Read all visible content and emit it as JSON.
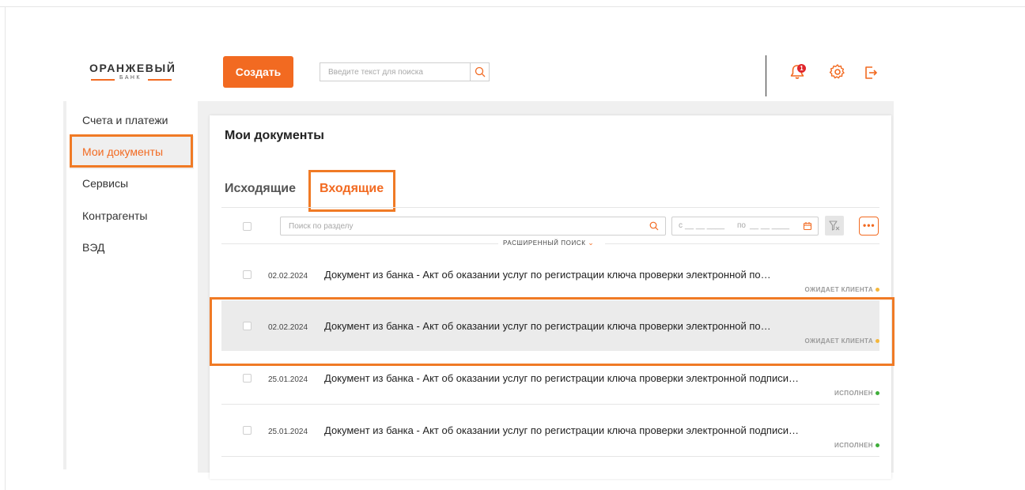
{
  "logo": {
    "name": "ОРАНЖЕВЫЙ",
    "subtitle": "БАНК"
  },
  "header": {
    "create_label": "Создать",
    "search_placeholder": "Введите текст для поиска",
    "notification_count": "1"
  },
  "sidebar": {
    "items": [
      {
        "label": "Счета и платежи",
        "active": false
      },
      {
        "label": "Мои документы",
        "active": true
      },
      {
        "label": "Сервисы",
        "active": false
      },
      {
        "label": "Контрагенты",
        "active": false
      },
      {
        "label": "ВЭД",
        "active": false
      }
    ]
  },
  "page": {
    "title": "Мои документы"
  },
  "tabs": [
    {
      "label": "Исходящие",
      "active": false
    },
    {
      "label": "Входящие",
      "active": true
    }
  ],
  "filters": {
    "section_search_placeholder": "Поиск по разделу",
    "date_from": "с",
    "date_to": "по",
    "advanced_search": "РАСШИРЕННЫЙ ПОИСК"
  },
  "documents": [
    {
      "date": "02.02.2024",
      "title": "Документ из банка - Акт об оказании услуг по регистрации ключа проверки электронной по…",
      "status": "ОЖИДАЕТ КЛИЕНТА",
      "status_color": "#f5b73b",
      "selected": false
    },
    {
      "date": "02.02.2024",
      "title": "Документ из банка - Акт об оказании услуг по регистрации ключа проверки электронной по…",
      "status": "ОЖИДАЕТ КЛИЕНТА",
      "status_color": "#f5b73b",
      "selected": true
    },
    {
      "date": "25.01.2024",
      "title": "Документ из банка - Акт об оказании услуг по регистрации ключа проверки электронной подписи…",
      "status": "ИСПОЛНЕН",
      "status_color": "#3fae3a",
      "selected": false
    },
    {
      "date": "25.01.2024",
      "title": "Документ из банка - Акт об оказании услуг по регистрации ключа проверки электронной подписи…",
      "status": "ИСПОЛНЕН",
      "status_color": "#3fae3a",
      "selected": false
    }
  ],
  "colors": {
    "accent": "#f26a21",
    "highlight": "#f07a25",
    "waiting": "#f5b73b",
    "done": "#3fae3a"
  }
}
